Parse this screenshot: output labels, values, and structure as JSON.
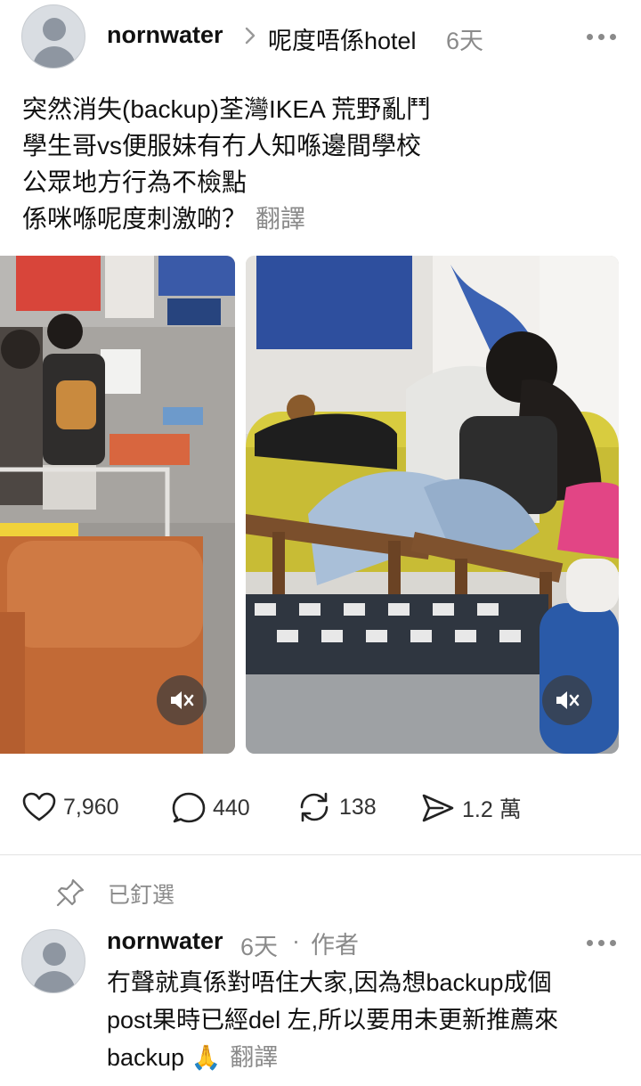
{
  "post": {
    "username": "nornwater",
    "community": "呢度唔係hotel",
    "time": "6天",
    "lines": [
      "突然消失(backup)荃灣IKEA 荒野亂鬥",
      "學生哥vs便服妹有冇人知喺邊間學校",
      "公眾地方行為不檢點",
      "係咪喺呢度刺激啲？"
    ],
    "translate_label": "翻譯",
    "media_icons": [
      "mute-icon",
      "mute-icon"
    ]
  },
  "actions": {
    "likes": "7,960",
    "comments": "440",
    "reposts": "138",
    "shares": "1.2 萬"
  },
  "pinned": {
    "label": "已釘選"
  },
  "reply": {
    "username": "nornwater",
    "time": "6天",
    "separator": "·",
    "author_badge": "作者",
    "lines": [
      "冇聲就真係對唔住大家,因為想backup成個",
      "post果時已經del 左,所以要用未更新推薦來",
      "backup"
    ],
    "emoji": "🙏",
    "translate_label": "翻譯"
  },
  "colors": {
    "muted": "#8a8a8a",
    "divider": "#e3e3e3"
  }
}
